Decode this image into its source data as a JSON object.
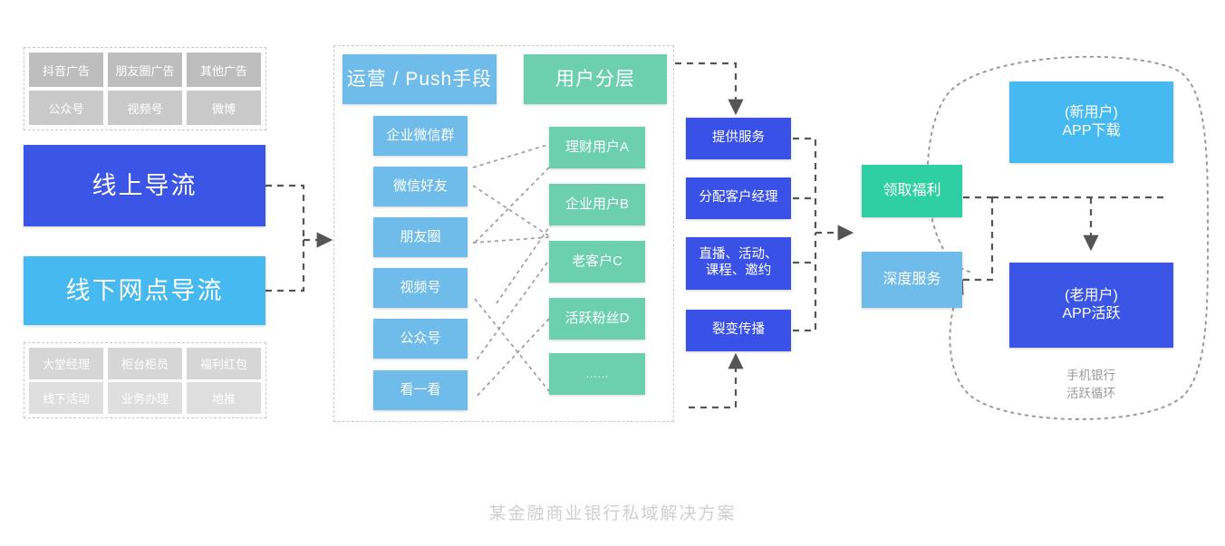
{
  "caption": "某金融商业银行私域解决方案",
  "online_sources": {
    "panel_name": "online-traffic-sources",
    "items": [
      {
        "label": "抖音广告"
      },
      {
        "label": "朋友圈广告"
      },
      {
        "label": "其他广告"
      },
      {
        "label": "公众号"
      },
      {
        "label": "视频号"
      },
      {
        "label": "微博"
      }
    ]
  },
  "online_entry": {
    "label": "线上导流",
    "color": "#3b55e6"
  },
  "offline_entry": {
    "label": "线下网点导流",
    "color": "#46b9f0"
  },
  "offline_sources": {
    "panel_name": "offline-traffic-sources",
    "items": [
      {
        "label": "大堂经理"
      },
      {
        "label": "柜台柜员"
      },
      {
        "label": "福利红包"
      },
      {
        "label": "线下活动"
      },
      {
        "label": "业务办理"
      },
      {
        "label": "地推"
      }
    ]
  },
  "middle_panel": {
    "operation_header": {
      "label": "运营 / Push手段",
      "color": "#6fbcea"
    },
    "segment_header": {
      "label": "用户分层",
      "color": "#6cd0ae"
    },
    "operation_items": [
      {
        "label": "企业微信群"
      },
      {
        "label": "微信好友"
      },
      {
        "label": "朋友圈"
      },
      {
        "label": "视频号"
      },
      {
        "label": "公众号"
      },
      {
        "label": "看一看"
      }
    ],
    "segment_items": [
      {
        "label": "理财用户A"
      },
      {
        "label": "企业用户B"
      },
      {
        "label": "老客户C"
      },
      {
        "label": "活跃粉丝D"
      },
      {
        "label": "……"
      }
    ]
  },
  "service_steps": [
    {
      "label": "提供服务"
    },
    {
      "label": "分配客户经理"
    },
    {
      "label": "直播、活动、\n课程、邀约",
      "line1": "直播、活动、",
      "line2": "课程、邀约"
    },
    {
      "label": "裂变传播"
    }
  ],
  "conversion": [
    {
      "label": "领取福利",
      "color": "#2ecfa3"
    },
    {
      "label": "深度服务",
      "color": "#6fbcea"
    }
  ],
  "app_stages": [
    {
      "line1": "(新用户)",
      "line2": "APP下载",
      "color": "#46b9f0"
    },
    {
      "line1": "(老用户)",
      "line2": "APP活跃",
      "color": "#3b55e6"
    }
  ],
  "loop_note": {
    "line1": "手机银行",
    "line2": "活跃循环"
  }
}
